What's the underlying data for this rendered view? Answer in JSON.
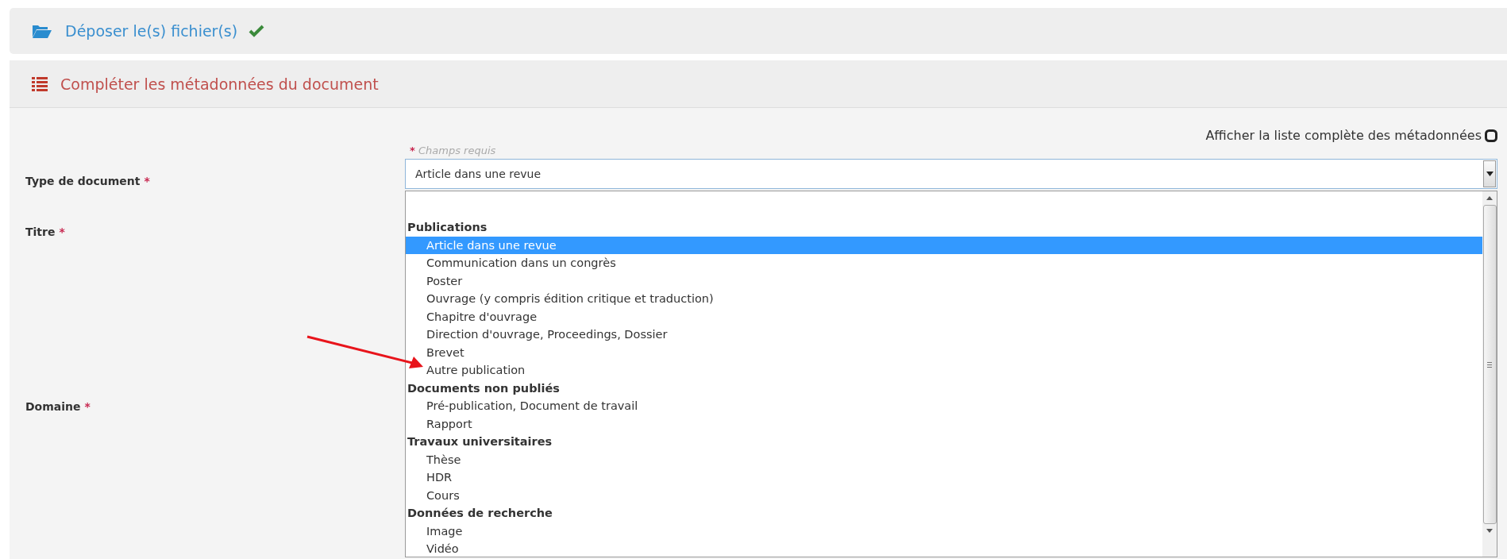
{
  "upload_section": {
    "title": "Déposer le(s) fichier(s)",
    "done": true
  },
  "metadata_section": {
    "title": "Compléter les métadonnées du document",
    "show_all_toggle": {
      "label": "Afficher la liste complète des métadonnées",
      "checked": false
    },
    "required_note": {
      "mark": "*",
      "text": "Champs requis"
    },
    "fields": [
      {
        "label": "Type de document",
        "required": true
      },
      {
        "label": "Titre",
        "required": true
      },
      {
        "label": "Domaine",
        "required": true
      }
    ],
    "document_type_select": {
      "value": "Article dans une revue",
      "expanded": true,
      "groups": [
        {
          "label": "Publications",
          "options": [
            {
              "label": "Article dans une revue",
              "selected": true
            },
            {
              "label": "Communication dans un congrès",
              "selected": false
            },
            {
              "label": "Poster",
              "selected": false
            },
            {
              "label": "Ouvrage (y compris édition critique et traduction)",
              "selected": false
            },
            {
              "label": "Chapitre d'ouvrage",
              "selected": false
            },
            {
              "label": "Direction d'ouvrage, Proceedings, Dossier",
              "selected": false
            },
            {
              "label": "Brevet",
              "selected": false
            },
            {
              "label": "Autre publication",
              "selected": false
            }
          ]
        },
        {
          "label": "Documents non publiés",
          "options": [
            {
              "label": "Pré-publication, Document de travail",
              "selected": false
            },
            {
              "label": "Rapport",
              "selected": false
            }
          ]
        },
        {
          "label": "Travaux universitaires",
          "options": [
            {
              "label": "Thèse",
              "selected": false
            },
            {
              "label": "HDR",
              "selected": false
            },
            {
              "label": "Cours",
              "selected": false
            }
          ]
        },
        {
          "label": "Données de recherche",
          "options": [
            {
              "label": "Image",
              "selected": false
            },
            {
              "label": "Vidéo",
              "selected": false
            }
          ]
        }
      ]
    }
  }
}
